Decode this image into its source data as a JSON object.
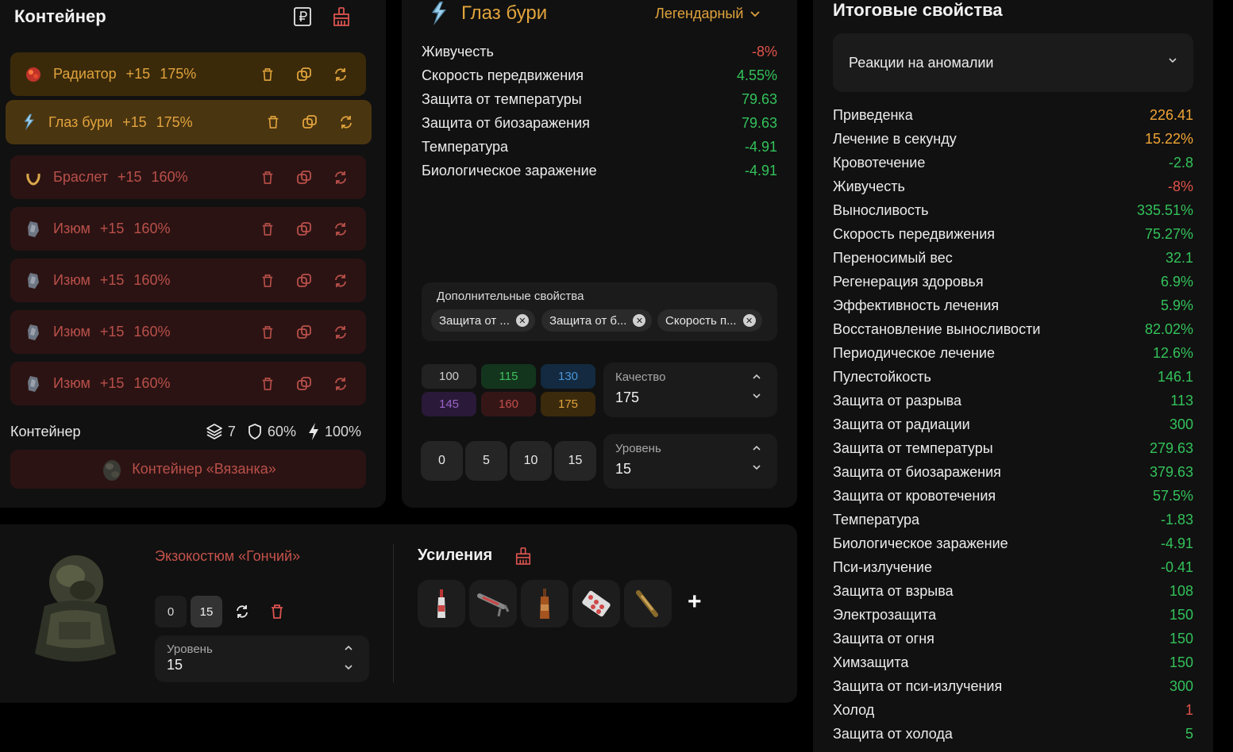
{
  "left": {
    "title": "Контейнер",
    "slots": [
      {
        "name": "Радиатор",
        "level": "+15",
        "percent": "175%",
        "tone": "gold",
        "icon": "radiator-icon"
      },
      {
        "name": "Глаз бури",
        "level": "+15",
        "percent": "175%",
        "tone": "gold",
        "icon": "storm-eye-icon",
        "selected": true
      },
      {
        "name": "Браслет",
        "level": "+15",
        "percent": "160%",
        "tone": "red",
        "icon": "bracelet-icon"
      },
      {
        "name": "Изюм",
        "level": "+15",
        "percent": "160%",
        "tone": "red",
        "icon": "raisin-icon"
      },
      {
        "name": "Изюм",
        "level": "+15",
        "percent": "160%",
        "tone": "red",
        "icon": "raisin-icon"
      },
      {
        "name": "Изюм",
        "level": "+15",
        "percent": "160%",
        "tone": "red",
        "icon": "raisin-icon"
      },
      {
        "name": "Изюм",
        "level": "+15",
        "percent": "160%",
        "tone": "red",
        "icon": "raisin-icon"
      }
    ],
    "container_label": "Контейнер",
    "container_stats": {
      "slots": "7",
      "protection": "60%",
      "efficiency": "100%"
    },
    "container_button": "Контейнер «Вязанка»"
  },
  "middle": {
    "artifact_name": "Глаз бури",
    "rarity": "Легендарный",
    "properties": [
      {
        "name": "Живучесть",
        "value": "-8%",
        "tone": "red"
      },
      {
        "name": "Скорость передвижения",
        "value": "4.55%",
        "tone": "green"
      },
      {
        "name": "Защита от температуры",
        "value": "79.63",
        "tone": "green"
      },
      {
        "name": "Защита от биозаражения",
        "value": "79.63",
        "tone": "green"
      },
      {
        "name": "Температура",
        "value": "-4.91",
        "tone": "green"
      },
      {
        "name": "Биологическое заражение",
        "value": "-4.91",
        "tone": "green"
      }
    ],
    "extra_title": "Дополнительные свойства",
    "extra_chips": [
      "Защита от ...",
      "Защита от б...",
      "Скорость п..."
    ],
    "quality_buttons": [
      {
        "label": "100",
        "bg": "#222222",
        "fg": "#cfcfcf"
      },
      {
        "label": "115",
        "bg": "#13351d",
        "fg": "#3fbf5e"
      },
      {
        "label": "130",
        "bg": "#132a40",
        "fg": "#4a95d6"
      },
      {
        "label": "145",
        "bg": "#2a1938",
        "fg": "#9a62c8"
      },
      {
        "label": "160",
        "bg": "#351617",
        "fg": "#c24f4a"
      },
      {
        "label": "175",
        "bg": "#3b2a0c",
        "fg": "#e1a33c"
      }
    ],
    "quality_label": "Качество",
    "quality_value": "175",
    "level_buttons": [
      "0",
      "5",
      "10",
      "15"
    ],
    "level_label": "Уровень",
    "level_value": "15"
  },
  "bottom": {
    "suit_name": "Экзокостюм «Гончий»",
    "suit_levels": [
      "0",
      "15"
    ],
    "level_label": "Уровень",
    "level_value": "15",
    "boost_title": "Усиления",
    "boosts": [
      "vodka-bottle-icon",
      "syringe-icon",
      "bottle-icon",
      "pills-icon",
      "injector-icon"
    ],
    "add_label": "+"
  },
  "right": {
    "title": "Итоговые свойства",
    "dropdown": "Реакции на аномалии",
    "stats": [
      {
        "name": "Приведенка",
        "value": "226.41",
        "tone": "orange"
      },
      {
        "name": "Лечение в секунду",
        "value": "15.22%",
        "tone": "orange"
      },
      {
        "name": "Кровотечение",
        "value": "-2.8",
        "tone": "green"
      },
      {
        "name": "Живучесть",
        "value": "-8%",
        "tone": "red"
      },
      {
        "name": "Выносливость",
        "value": "335.51%",
        "tone": "green"
      },
      {
        "name": "Скорость передвижения",
        "value": "75.27%",
        "tone": "green"
      },
      {
        "name": "Переносимый вес",
        "value": "32.1",
        "tone": "green"
      },
      {
        "name": "Регенерация здоровья",
        "value": "6.9%",
        "tone": "green"
      },
      {
        "name": "Эффективность лечения",
        "value": "5.9%",
        "tone": "green"
      },
      {
        "name": "Восстановление выносливости",
        "value": "82.02%",
        "tone": "green"
      },
      {
        "name": "Периодическое лечение",
        "value": "12.6%",
        "tone": "green"
      },
      {
        "name": "Пулестойкость",
        "value": "146.1",
        "tone": "green"
      },
      {
        "name": "Защита от разрыва",
        "value": "113",
        "tone": "green"
      },
      {
        "name": "Защита от радиации",
        "value": "300",
        "tone": "green"
      },
      {
        "name": "Защита от температуры",
        "value": "279.63",
        "tone": "green"
      },
      {
        "name": "Защита от биозаражения",
        "value": "379.63",
        "tone": "green"
      },
      {
        "name": "Защита от кровотечения",
        "value": "57.5%",
        "tone": "green"
      },
      {
        "name": "Температура",
        "value": "-1.83",
        "tone": "green"
      },
      {
        "name": "Биологическое заражение",
        "value": "-4.91",
        "tone": "green"
      },
      {
        "name": "Пси-излучение",
        "value": "-0.41",
        "tone": "green"
      },
      {
        "name": "Защита от взрыва",
        "value": "108",
        "tone": "green"
      },
      {
        "name": "Электрозащита",
        "value": "150",
        "tone": "green"
      },
      {
        "name": "Защита от огня",
        "value": "150",
        "tone": "green"
      },
      {
        "name": "Химзащита",
        "value": "150",
        "tone": "green"
      },
      {
        "name": "Защита от пси-излучения",
        "value": "300",
        "tone": "green"
      },
      {
        "name": "Холод",
        "value": "1",
        "tone": "red"
      },
      {
        "name": "Защита от холода",
        "value": "5",
        "tone": "green"
      }
    ]
  },
  "colors": {
    "gold": "#e1a33c",
    "red": "#b9504a",
    "green": "#33c25a",
    "orange": "#f0a535",
    "panel": "#111111"
  }
}
